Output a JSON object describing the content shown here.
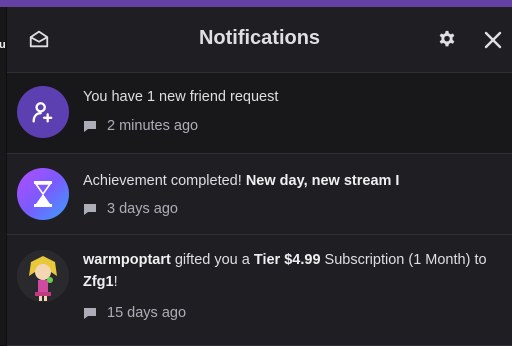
{
  "left_edge_letter": "u",
  "header": {
    "title": "Notifications"
  },
  "notifications": [
    {
      "type": "friend-request",
      "text": "You have 1 new friend request",
      "time": "2 minutes ago",
      "unread": true
    },
    {
      "type": "achievement",
      "text_prefix": "Achievement completed! ",
      "text_bold": "New day, new stream I",
      "time": "3 days ago",
      "unread": false
    },
    {
      "type": "gift-sub",
      "user": "warmpoptart",
      "text_mid": " gifted you a ",
      "tier": "Tier $4.99",
      "text_after_tier": " Subscription (1 Month) to ",
      "channel": "Zfg1",
      "text_end": "!",
      "time": "15 days ago",
      "unread": false
    }
  ],
  "colors": {
    "accent": "#6441a5",
    "panel": "#1f1f23",
    "unread_bg": "#18181b"
  }
}
